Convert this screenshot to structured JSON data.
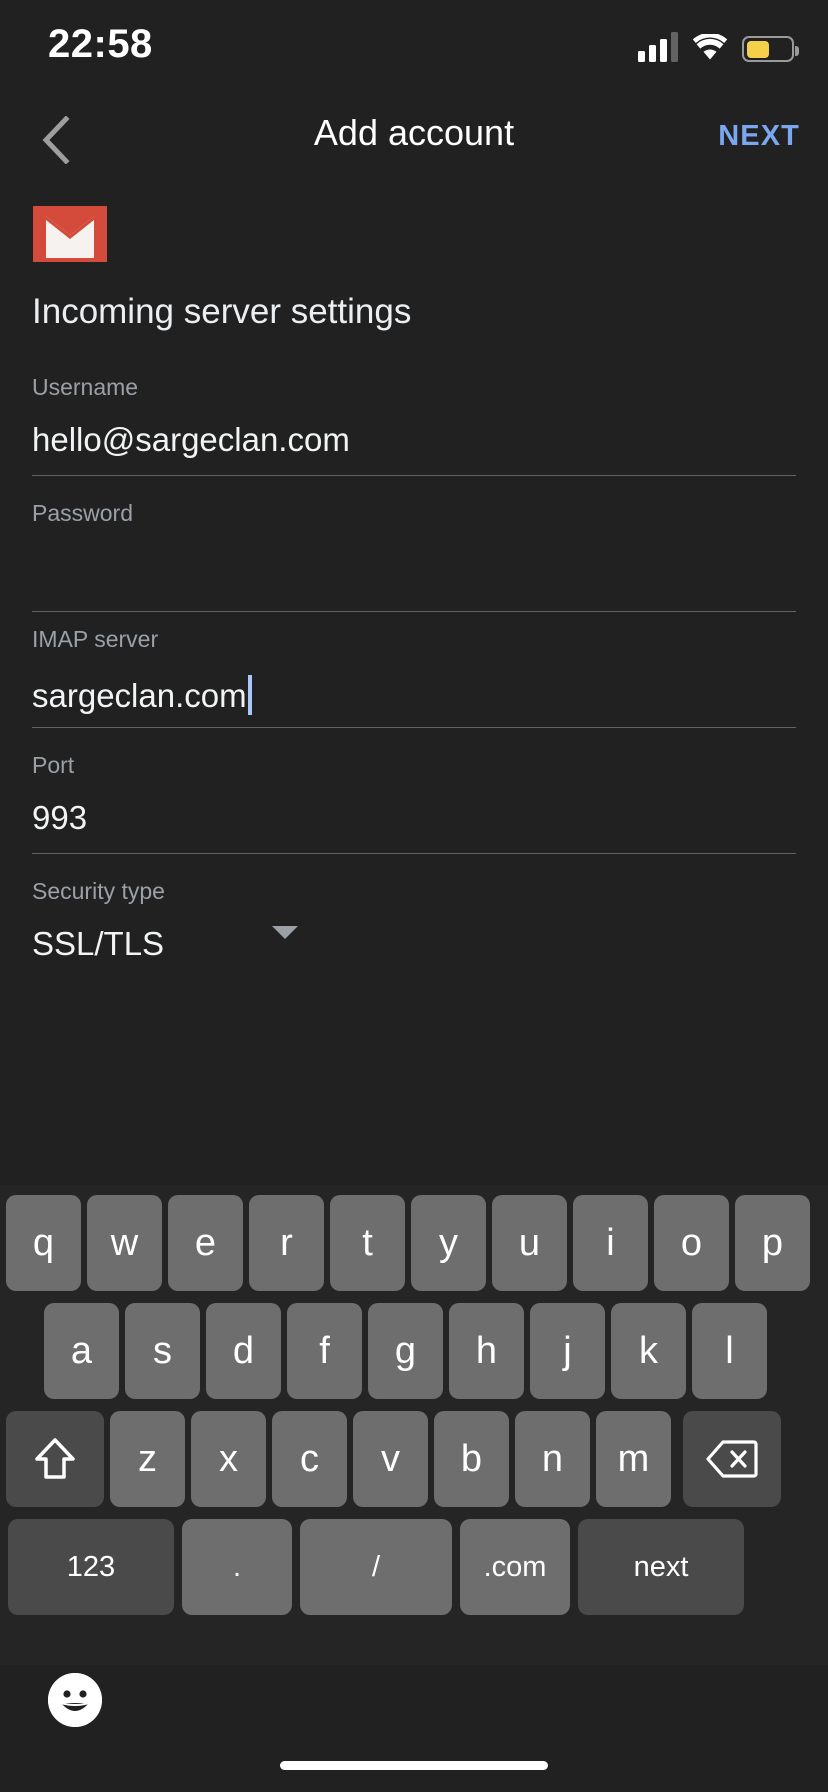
{
  "status_bar": {
    "time": "22:58",
    "signal_icon": "cellular-signal-icon",
    "wifi_icon": "wifi-icon",
    "battery_icon": "battery-low-power-icon",
    "battery_color": "#f5d14b",
    "battery_level_percent": 46
  },
  "app_bar": {
    "back_icon": "chevron-left-icon",
    "title": "Add account",
    "next_label": "NEXT",
    "next_color": "#7ba6f0"
  },
  "content": {
    "app_logo": "gmail-icon",
    "section_title": "Incoming server settings",
    "fields": [
      {
        "label": "Username",
        "value": "hello@sargeclan.com",
        "focused": false
      },
      {
        "label": "Password",
        "value": "",
        "focused": false
      },
      {
        "label": "IMAP server",
        "value": "sargeclan.com",
        "focused": true
      },
      {
        "label": "Port",
        "value": "993",
        "focused": false
      },
      {
        "label": "Security type",
        "value": "SSL/TLS",
        "focused": false
      }
    ],
    "caret_color": "#a8c7fa"
  },
  "keyboard": {
    "row1": [
      "q",
      "w",
      "e",
      "r",
      "t",
      "y",
      "u",
      "i",
      "o",
      "p"
    ],
    "row2": [
      "a",
      "s",
      "d",
      "f",
      "g",
      "h",
      "j",
      "k",
      "l"
    ],
    "row3_letters": [
      "z",
      "x",
      "c",
      "v",
      "b",
      "n",
      "m"
    ],
    "shift_icon": "shift-up-arrow-icon",
    "backspace_icon": "backspace-delete-icon",
    "row4": [
      {
        "label": "123",
        "name": "numeric-mode-key"
      },
      {
        "label": ".",
        "name": "period-key"
      },
      {
        "label": "/",
        "name": "slash-key"
      },
      {
        "label": ".com",
        "name": "dot-com-key"
      },
      {
        "label": "next",
        "name": "next-action-key"
      }
    ],
    "emoji_icon": "emoji-smiley-icon"
  }
}
